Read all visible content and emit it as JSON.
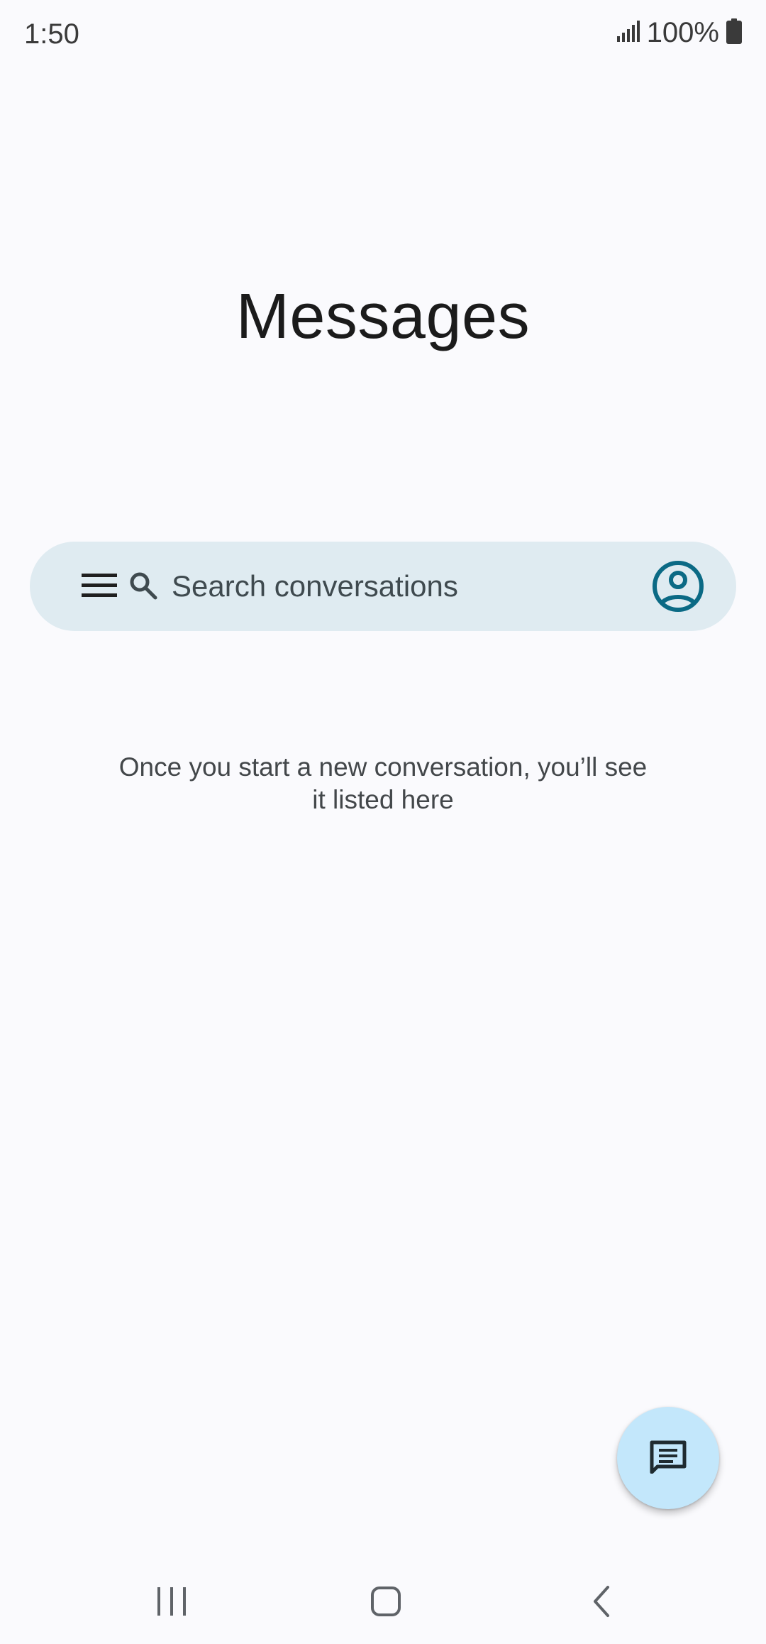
{
  "status_bar": {
    "time": "1:50",
    "battery_text": "100%",
    "icons": [
      "signal-icon",
      "battery-icon"
    ]
  },
  "app": {
    "title": "Messages"
  },
  "search": {
    "placeholder": "Search conversations",
    "value": "",
    "icons": [
      "menu-icon",
      "search-icon",
      "account-icon"
    ]
  },
  "empty_state": {
    "line1": "Once you start a new conversation, you’ll see",
    "line2": "it listed here"
  },
  "fab": {
    "icon": "start-chat-icon"
  },
  "nav_bar": {
    "icons": [
      "recent-apps-icon",
      "home-icon",
      "back-icon"
    ]
  },
  "colors": {
    "background": "#FAFAFD",
    "search_bar": "#DFEBF1",
    "account_icon": "#0B6A85",
    "fab": "#C3E7FB",
    "nav_icon": "#5F6368"
  }
}
